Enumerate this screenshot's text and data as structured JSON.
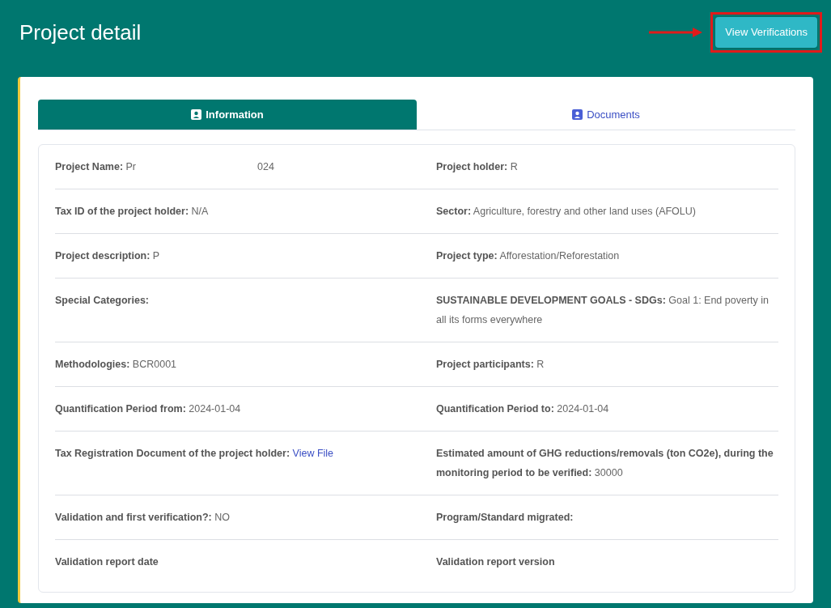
{
  "header": {
    "title": "Project detail",
    "button": "View Verifications",
    "annotation": {
      "arrow": true,
      "highlight": true
    }
  },
  "tabs": [
    {
      "label": "Information",
      "selected": true
    },
    {
      "label": "Documents",
      "selected": false
    }
  ],
  "rows": [
    {
      "left": {
        "label": "Project Name:",
        "value": "Pr",
        "value_after_gap": "024"
      },
      "right": {
        "label": "Project holder:",
        "value": "R"
      }
    },
    {
      "left": {
        "label": "Tax ID of the project holder:",
        "value": "N/A"
      },
      "right": {
        "label": "Sector:",
        "value": "Agriculture, forestry and other land uses (AFOLU)"
      }
    },
    {
      "left": {
        "label": "Project description:",
        "value": "P"
      },
      "right": {
        "label": "Project type:",
        "value": "Afforestation/Reforestation"
      }
    },
    {
      "left": {
        "label": "Special Categories:"
      },
      "right": {
        "label": "SUSTAINABLE DEVELOPMENT GOALS - SDGs:",
        "value": "Goal 1: End poverty in all its forms everywhere"
      }
    },
    {
      "left": {
        "label": "Methodologies:",
        "value": "BCR0001"
      },
      "right": {
        "label": "Project participants:",
        "value": "R"
      }
    },
    {
      "left": {
        "label": "Quantification Period from:",
        "value": "2024-01-04"
      },
      "right": {
        "label": "Quantification Period to:",
        "value": "2024-01-04"
      }
    },
    {
      "left": {
        "label": "Tax Registration Document of the project holder:",
        "link": "View File"
      },
      "right": {
        "label": "Estimated amount of GHG reductions/removals (ton CO2e), during the monitoring period to be verified:",
        "value": "30000"
      }
    },
    {
      "left": {
        "label": "Validation and first verification?:",
        "value": "NO"
      },
      "right": {
        "label": "Program/Standard migrated:"
      }
    },
    {
      "left": {
        "label": "Validation report date"
      },
      "right": {
        "label": "Validation report version"
      }
    }
  ]
}
